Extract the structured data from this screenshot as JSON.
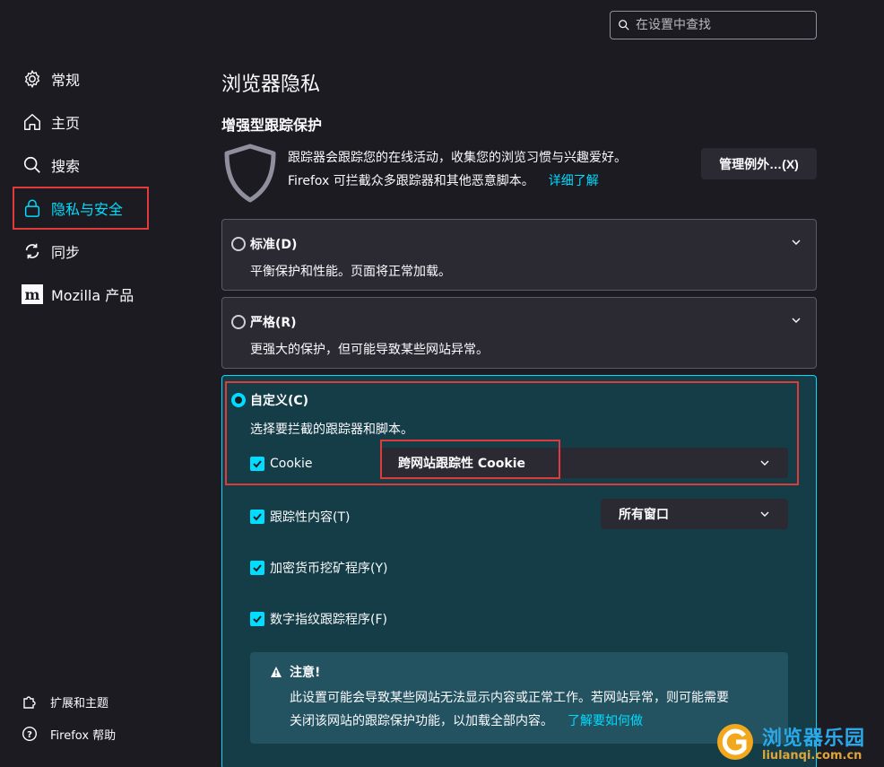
{
  "search": {
    "placeholder": "在设置中查找"
  },
  "nav": {
    "items": [
      {
        "label": "常规",
        "icon": "gear-icon"
      },
      {
        "label": "主页",
        "icon": "home-icon"
      },
      {
        "label": "搜索",
        "icon": "search-icon"
      },
      {
        "label": "隐私与安全",
        "icon": "lock-icon",
        "selected": true
      },
      {
        "label": "同步",
        "icon": "sync-icon"
      },
      {
        "label": "Mozilla 产品",
        "icon": "mozilla-icon"
      }
    ],
    "footer": [
      {
        "label": "扩展和主题",
        "icon": "puzzle-icon"
      },
      {
        "label": "Firefox 帮助",
        "icon": "help-icon"
      }
    ]
  },
  "main": {
    "page_title": "浏览器隐私",
    "section_title": "增强型跟踪保护",
    "desc_line1": "跟踪器会跟踪您的在线活动，收集您的浏览习惯与兴趣爱好。",
    "desc_line2": "Firefox 可拦截众多跟踪器和其他恶意脚本。",
    "learn_more": "详细了解",
    "manage_button": "管理例外…(X)"
  },
  "options": {
    "standard": {
      "title": "标准(D)",
      "desc": "平衡保护和性能。页面将正常加载。"
    },
    "strict": {
      "title": "严格(R)",
      "desc": "更强大的保护，但可能导致某些网站异常。"
    },
    "custom": {
      "title": "自定义(C)",
      "desc": "选择要拦截的跟踪器和脚本。",
      "cookie_label": "Cookie",
      "cookie_select": "跨网站跟踪性 Cookie",
      "tracking_label": "跟踪性内容(T)",
      "tracking_select": "所有窗口",
      "crypto_label": "加密货币挖矿程序(Y)",
      "fingerprint_label": "数字指纹跟踪程序(F)"
    }
  },
  "warning": {
    "title": "注意!",
    "line1": "此设置可能会导致某些网站无法显示内容或正常工作。若网站异常，则可能需要",
    "line2": "关闭该网站的跟踪保护功能，以加载全部内容。",
    "link": "了解要如何做"
  },
  "watermark": {
    "cn": "浏览器乐园",
    "en": "liulanqi.com.cn"
  },
  "colors": {
    "accent": "#00ddff",
    "highlight": "#e03b3b",
    "bg": "#1c1b22",
    "card": "#2b2a33"
  }
}
